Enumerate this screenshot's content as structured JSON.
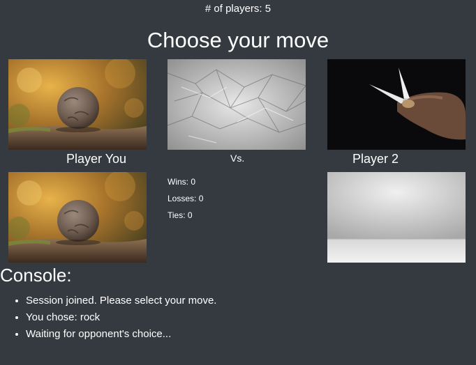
{
  "header": {
    "players_count": "# of players: 5",
    "title": "Choose your move"
  },
  "moves": [
    {
      "name": "rock",
      "image": "rock-photo"
    },
    {
      "name": "paper",
      "image": "crumpled-paper-photo"
    },
    {
      "name": "scissors",
      "image": "scissors-photo"
    }
  ],
  "board": {
    "player_you_label": "Player You",
    "vs_label": "Vs.",
    "player_2_label": "Player 2",
    "player_you_choice": "rock",
    "opponent_choice": "empty-placeholder"
  },
  "stats": {
    "wins": "Wins: 0",
    "losses": "Losses: 0",
    "ties": "Ties: 0"
  },
  "console": {
    "heading": "Console:",
    "messages": [
      "Session joined. Please select your move.",
      "You chose: rock",
      "Waiting for opponent's choice..."
    ]
  },
  "colors": {
    "background": "#343a40",
    "text": "#ffffff"
  }
}
